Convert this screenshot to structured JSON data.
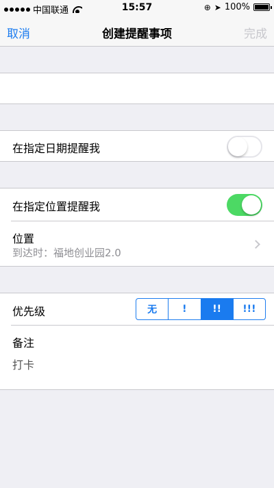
{
  "status_bar": {
    "carrier": "中国联通",
    "time": "15:57",
    "battery": "100%"
  },
  "nav": {
    "cancel": "取消",
    "title": "创建提醒事项",
    "done": "完成"
  },
  "title_field": {
    "value": ""
  },
  "date_reminder": {
    "label": "在指定日期提醒我",
    "enabled": false
  },
  "location_reminder": {
    "label": "在指定位置提醒我",
    "enabled": true
  },
  "location": {
    "label": "位置",
    "value": "到达时：福地创业园2.0"
  },
  "priority": {
    "label": "优先级",
    "options": [
      "无",
      "!",
      "!!",
      "!!!"
    ],
    "selected": "!!"
  },
  "notes": {
    "label": "备注",
    "value": "打卡"
  },
  "colors": {
    "accent": "#1a7bef",
    "toggle_on": "#4cd964",
    "background": "#efeff4"
  }
}
